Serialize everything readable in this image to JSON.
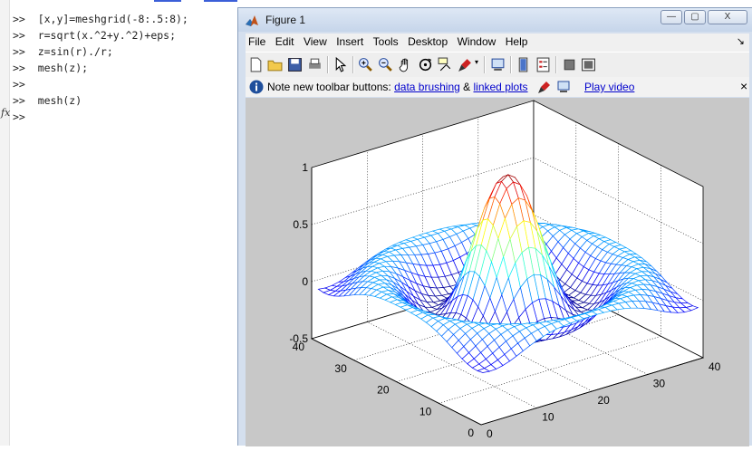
{
  "command_window": {
    "lines": [
      ">>  [x,y]=meshgrid(-8:.5:8);",
      ">>  r=sqrt(x.^2+y.^2)+eps;",
      ">>  z=sin(r)./r;",
      ">>  mesh(z);",
      ">>",
      ">>  mesh(z)",
      ">>"
    ],
    "fx_label": "fx"
  },
  "figure": {
    "title": "Figure 1",
    "window_buttons": {
      "minimize": "—",
      "maximize": "▢",
      "close": "X"
    },
    "menu": [
      "File",
      "Edit",
      "View",
      "Insert",
      "Tools",
      "Desktop",
      "Window",
      "Help"
    ],
    "menu_arrow": "↘",
    "infobar": {
      "text": "Note new toolbar buttons: ",
      "link1": "data brushing",
      "amp": " & ",
      "link2": "linked plots",
      "link3": "Play video",
      "close": "×"
    }
  },
  "chart_data": {
    "type": "mesh",
    "function": "z=sin(r)./r, r=sqrt(x.^2+y.^2)+eps, [x,y]=meshgrid(-8:.5:8)",
    "grid_size": [
      33,
      33
    ],
    "x_ticks": [
      "0",
      "10",
      "20",
      "30",
      "40"
    ],
    "y_ticks": [
      "0",
      "10",
      "20",
      "30",
      "40"
    ],
    "z_ticks": [
      "-0.5",
      "0",
      "0.5",
      "1"
    ],
    "xlim": [
      0,
      40
    ],
    "ylim": [
      0,
      40
    ],
    "zlim": [
      -0.5,
      1
    ],
    "grid": "on",
    "colormap": "jet"
  }
}
